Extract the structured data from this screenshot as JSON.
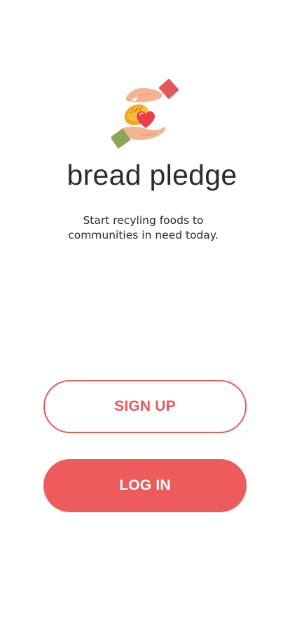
{
  "app": {
    "name": "bread pledge",
    "tagline_line1": "Start recyling foods to",
    "tagline_line2": "communities in need today."
  },
  "logo": {
    "icon": "hands-sharing-bread-heart-icon"
  },
  "actions": {
    "signup_label": "SIGN UP",
    "login_label": "LOG IN"
  },
  "colors": {
    "accent": "#ED5B5C",
    "text": "#2B2B2B",
    "background": "#FFFFFF"
  }
}
